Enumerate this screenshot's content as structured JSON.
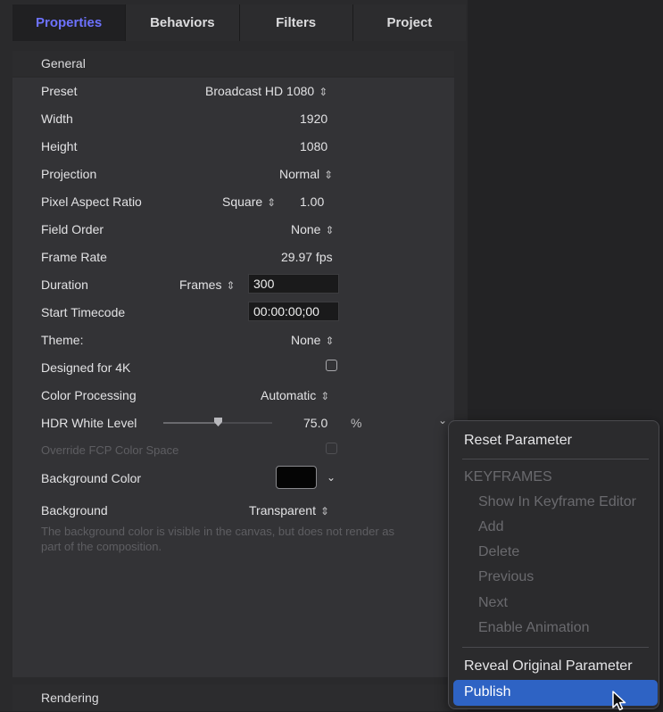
{
  "tabs": [
    {
      "label": "Properties",
      "active": true
    },
    {
      "label": "Behaviors"
    },
    {
      "label": "Filters"
    },
    {
      "label": "Project"
    }
  ],
  "general": {
    "header": "General",
    "preset": {
      "label": "Preset",
      "value": "Broadcast HD 1080"
    },
    "width": {
      "label": "Width",
      "value": "1920"
    },
    "height": {
      "label": "Height",
      "value": "1080"
    },
    "projection": {
      "label": "Projection",
      "value": "Normal"
    },
    "pixel_aspect": {
      "label": "Pixel Aspect Ratio",
      "value": "Square",
      "number": "1.00"
    },
    "field_order": {
      "label": "Field Order",
      "value": "None"
    },
    "frame_rate": {
      "label": "Frame Rate",
      "value": "29.97 fps"
    },
    "duration": {
      "label": "Duration",
      "unit": "Frames",
      "value": "300"
    },
    "start_timecode": {
      "label": "Start Timecode",
      "value": "00:00:00;00"
    },
    "theme": {
      "label": "Theme:",
      "value": "None"
    },
    "designed_4k": {
      "label": "Designed for 4K",
      "checked": false
    },
    "color_processing": {
      "label": "Color Processing",
      "value": "Automatic"
    },
    "hdr_white": {
      "label": "HDR White Level",
      "value": "75.0",
      "unit": "%",
      "slider_fraction": 0.5
    },
    "override_fcp": {
      "label": "Override FCP Color Space",
      "checked": false
    },
    "background_color": {
      "label": "Background Color",
      "color": "#050505"
    },
    "background": {
      "label": "Background",
      "value": "Transparent"
    },
    "note": "The background color is visible in the canvas, but does not render as part of the composition."
  },
  "rendering": {
    "header": "Rendering"
  },
  "context_menu": {
    "reset": "Reset Parameter",
    "keyframes_header": "KEYFRAMES",
    "show_editor": "Show In Keyframe Editor",
    "add": "Add",
    "delete": "Delete",
    "previous": "Previous",
    "next": "Next",
    "enable_animation": "Enable Animation",
    "reveal": "Reveal Original Parameter",
    "publish": "Publish"
  },
  "colors": {
    "accent": "#6d72ff",
    "highlight": "#2e63c4"
  }
}
